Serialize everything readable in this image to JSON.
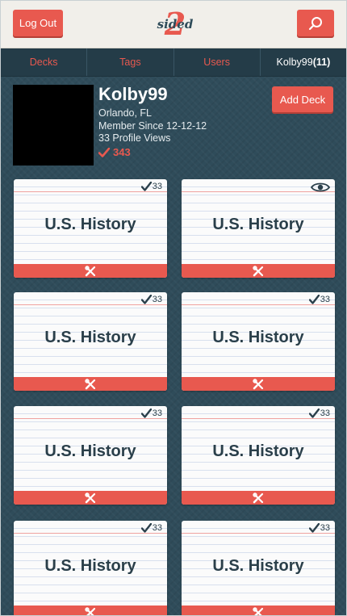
{
  "header": {
    "logout_label": "Log Out",
    "logo_text": "sided",
    "logo_numeral": "2"
  },
  "nav": {
    "decks": "Decks",
    "tags": "Tags",
    "users": "Users",
    "user_name": "Kolby99",
    "user_count": "(11)"
  },
  "profile": {
    "name": "Kolby99",
    "location": "Orlando, FL",
    "member_since": "Member Since 12-12-12",
    "profile_views": "33 Profile Views",
    "score": "343",
    "add_deck_label": "Add Deck"
  },
  "colors": {
    "accent": "#e8594f",
    "background": "#2f4c5a",
    "header_bg": "#f1efea"
  },
  "cards": [
    {
      "title": "U.S. History",
      "badge": "33",
      "badge_type": "check"
    },
    {
      "title": "U.S. History",
      "badge": "",
      "badge_type": "eye"
    },
    {
      "title": "U.S. History",
      "badge": "33",
      "badge_type": "check"
    },
    {
      "title": "U.S. History",
      "badge": "33",
      "badge_type": "check"
    },
    {
      "title": "U.S. History",
      "badge": "33",
      "badge_type": "check"
    },
    {
      "title": "U.S. History",
      "badge": "33",
      "badge_type": "check"
    },
    {
      "title": "U.S. History",
      "badge": "33",
      "badge_type": "check"
    },
    {
      "title": "U.S. History",
      "badge": "33",
      "badge_type": "check"
    }
  ]
}
